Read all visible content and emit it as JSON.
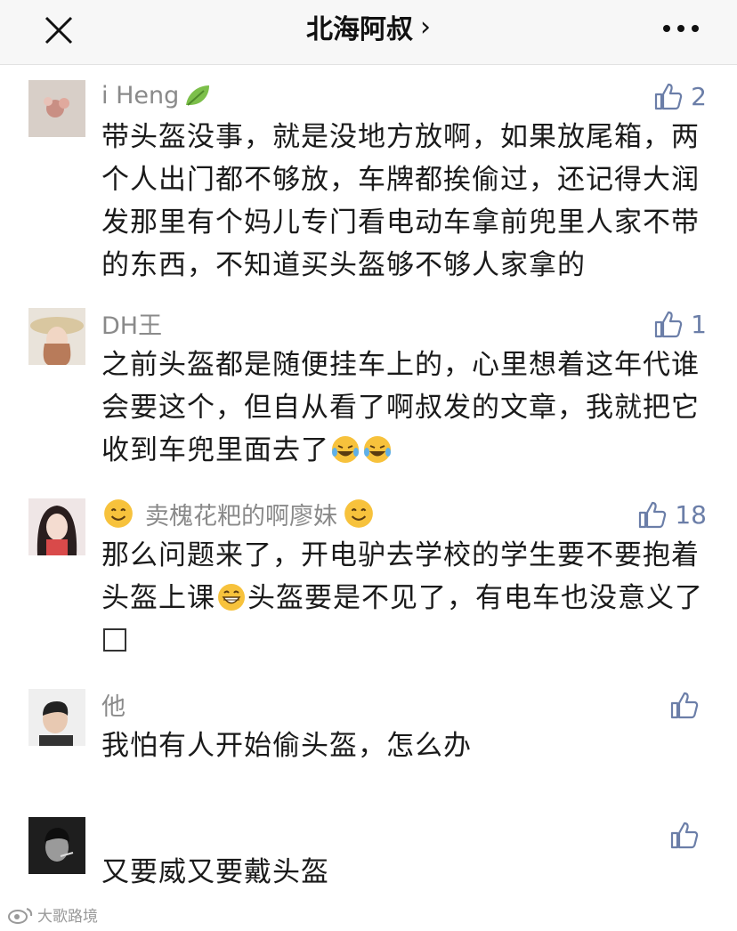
{
  "header": {
    "title": "北海阿叔",
    "chevron": "›",
    "close_icon": "close-icon",
    "more_icon": "more-icon"
  },
  "comments": [
    {
      "name": "i Heng",
      "likes": "2",
      "text": "带头盔没事，就是没地方放啊，如果放尾箱，两个人出门都不够放，车牌都挨偷过，还记得大润发那里有个妈儿专门看电动车拿前兜里人家不带的东西，不知道买头盔够不够人家拿的"
    },
    {
      "name": "DH王",
      "likes": "1",
      "text": "之前头盔都是随便挂车上的，心里想着这年代谁会要这个，但自从看了啊叔发的文章，我就把它收到车兜里面去了"
    },
    {
      "name": "卖槐花粑的啊廖妹",
      "likes": "18",
      "text_a": "那么问题来了，开电驴去学校的学生要不要抱着头盔上课",
      "text_b": "头盔要是不见了，有电车也没意义了"
    },
    {
      "name": "他",
      "likes": "",
      "text": "我怕有人开始偷头盔，怎么办"
    },
    {
      "name": "",
      "likes": "",
      "text": "又要威又要戴头盔"
    }
  ],
  "watermark": "大歌路境",
  "colors": {
    "like": "#6b7ea8",
    "name": "#8a8a8a",
    "topbar": "#f7f7f7"
  }
}
